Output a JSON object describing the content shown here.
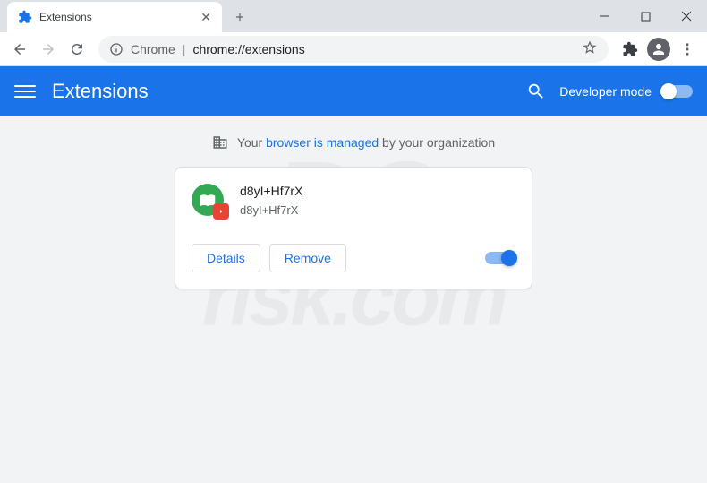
{
  "window": {
    "tab_title": "Extensions",
    "minimize": "—",
    "maximize": "☐",
    "close": "✕"
  },
  "toolbar": {
    "chrome_label": "Chrome",
    "url": "chrome://extensions"
  },
  "header": {
    "title": "Extensions",
    "dev_mode_label": "Developer mode"
  },
  "banner": {
    "prefix": "Your ",
    "link": "browser is managed",
    "suffix": " by your organization"
  },
  "extension": {
    "name": "d8yI+Hf7rX",
    "description": "d8yI+Hf7rX",
    "details_label": "Details",
    "remove_label": "Remove",
    "enabled": true
  },
  "watermark": {
    "line1": "PC",
    "line2": "risk.com"
  }
}
